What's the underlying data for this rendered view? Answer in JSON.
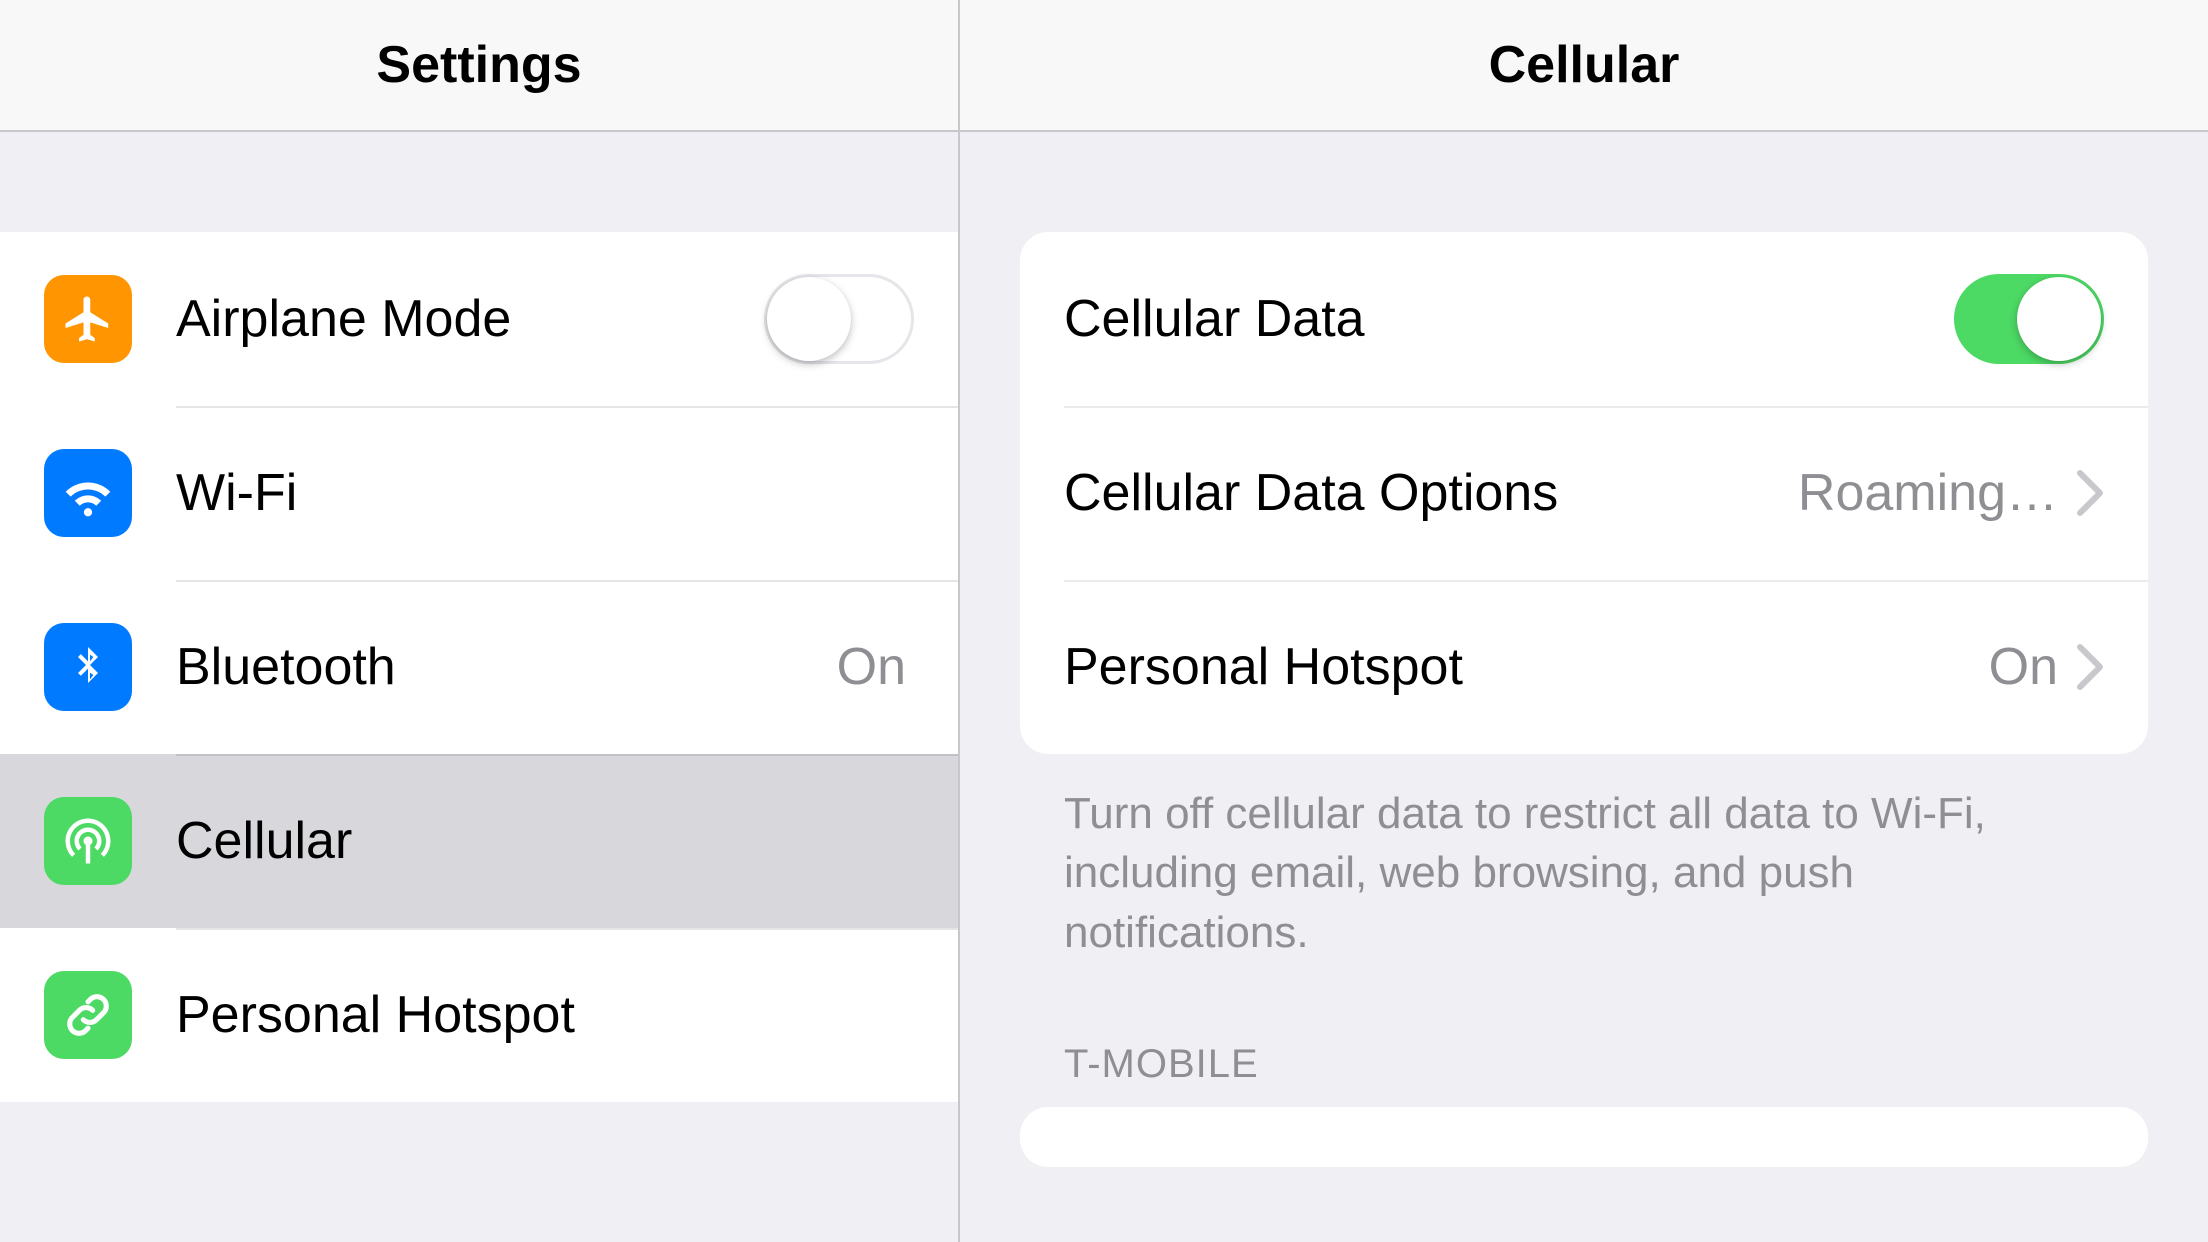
{
  "sidebar": {
    "title": "Settings",
    "items": [
      {
        "label": "Airplane Mode",
        "toggle": false
      },
      {
        "label": "Wi-Fi"
      },
      {
        "label": "Bluetooth",
        "value": "On"
      },
      {
        "label": "Cellular"
      },
      {
        "label": "Personal Hotspot"
      }
    ]
  },
  "detail": {
    "title": "Cellular",
    "items": [
      {
        "label": "Cellular Data",
        "toggle": true
      },
      {
        "label": "Cellular Data Options",
        "value": "Roaming…"
      },
      {
        "label": "Personal Hotspot",
        "value": "On"
      }
    ],
    "footer": "Turn off cellular data to restrict all data to Wi-Fi, including email, web browsing, and push notifications.",
    "section_header": "T-MOBILE"
  },
  "colors": {
    "airplane": "#ff9500",
    "wifi": "#007aff",
    "bluetooth": "#007aff",
    "cellular": "#4cd964",
    "hotspot": "#4cd964"
  }
}
